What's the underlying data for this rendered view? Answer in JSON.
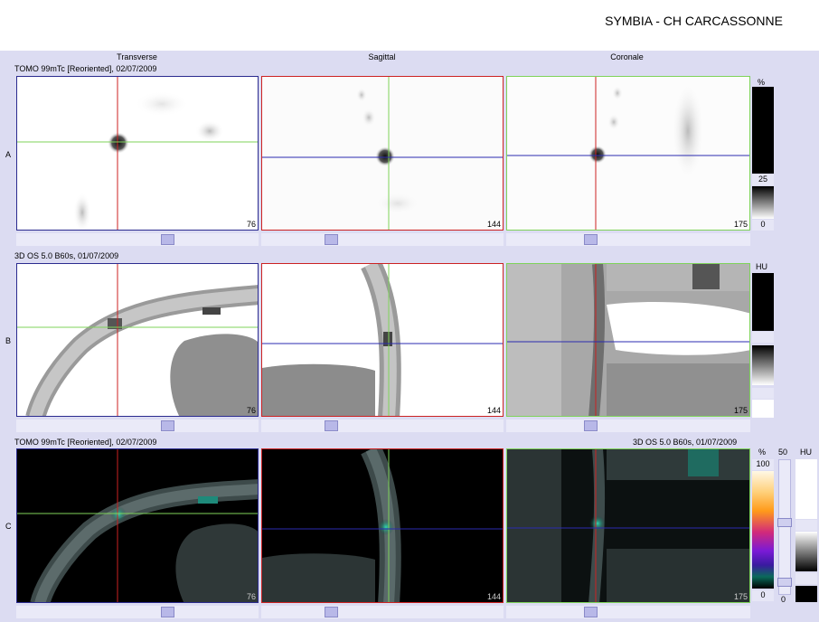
{
  "header": {
    "site_title": "SYMBIA - CH CARCASSONNE"
  },
  "columns": [
    "Transverse",
    "Sagittal",
    "Coronale"
  ],
  "rows": [
    {
      "label": "A",
      "series": "TOMO 99mTc [Reoriented], 02/07/2009",
      "right_series": "",
      "unit": "%"
    },
    {
      "label": "B",
      "series": "3D  OS  5.0  B60s, 01/07/2009",
      "right_series": "",
      "unit": "HU"
    },
    {
      "label": "C",
      "series": "TOMO 99mTc [Reoriented], 02/07/2009",
      "right_series": "3D  OS  5.0  B60s, 01/07/2009",
      "unit": "%"
    }
  ],
  "slice_numbers": [
    "76",
    "144",
    "175"
  ],
  "scales": {
    "A": {
      "top": "25",
      "bottom": "0"
    },
    "C": {
      "top": "100",
      "bottom": "0",
      "blend": "50",
      "ct_bottom": "0",
      "ct_unit": "HU"
    }
  },
  "colors": {
    "transverse_border": "#2b2b8f",
    "sagittal_border": "#cc2222",
    "coronal_border": "#7fd35a",
    "crosshair_red": "#cc2222",
    "crosshair_green": "#7fd35a",
    "crosshair_blue": "#2b2bb0"
  }
}
